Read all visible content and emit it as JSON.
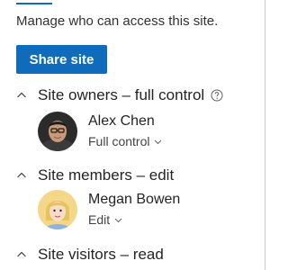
{
  "description": "Manage who can access this site.",
  "share_button_label": "Share site",
  "colors": {
    "accent": "#0f6cbd",
    "text": "#242424"
  },
  "sections": {
    "owners": {
      "title": "Site owners – full control",
      "expand_icon": "chevron-up-icon",
      "help_icon": "question-circle-icon",
      "member": {
        "name": "Alex Chen",
        "permission": "Full control"
      }
    },
    "members": {
      "title": "Site members – edit",
      "expand_icon": "chevron-up-icon",
      "member": {
        "name": "Megan Bowen",
        "permission": "Edit"
      }
    },
    "visitors": {
      "title": "Site visitors – read",
      "expand_icon": "chevron-up-icon"
    }
  }
}
